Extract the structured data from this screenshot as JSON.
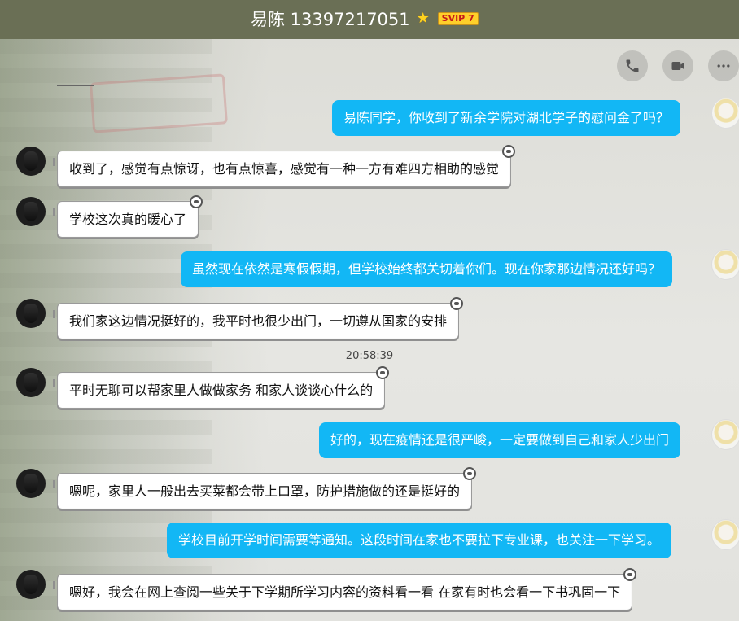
{
  "header": {
    "title": "易陈 13397217051",
    "vip": "SVIP 7"
  },
  "toolbar": {
    "buttons": [
      {
        "icon": "phone-icon"
      },
      {
        "icon": "video-icon"
      },
      {
        "icon": "more-icon"
      }
    ]
  },
  "messages": [
    {
      "side": "right",
      "text": "易陈同学，你收到了新余学院对湖北学子的慰问金了吗？"
    },
    {
      "side": "left",
      "text": "收到了，感觉有点惊讶，也有点惊喜，感觉有一种一方有难四方相助的感觉"
    },
    {
      "side": "left",
      "text": "学校这次真的暖心了"
    },
    {
      "side": "right",
      "text": "虽然现在依然是寒假假期，但学校始终都关切着你们。现在你家那边情况还好吗？"
    },
    {
      "side": "left",
      "text": "我们家这边情况挺好的，我平时也很少出门，一切遵从国家的安排"
    },
    {
      "side": "time",
      "text": "20:58:39"
    },
    {
      "side": "left",
      "text": "平时无聊可以帮家里人做做家务 和家人谈谈心什么的"
    },
    {
      "side": "right",
      "text": "好的，现在疫情还是很严峻，一定要做到自己和家人少出门"
    },
    {
      "side": "left",
      "text": "嗯呢，家里人一般出去买菜都会带上口罩，防护措施做的还是挺好的"
    },
    {
      "side": "right",
      "text": "学校目前开学时间需要等通知。这段时间在家也不要拉下专业课，也关注一下学习。"
    },
    {
      "side": "left",
      "text": "嗯好，我会在网上查阅一些关于下学期所学习内容的资料看一看 在家有时也会看一下书巩固一下"
    }
  ],
  "colors": {
    "titlebar": "#6a6f55",
    "bubble_right": "#12b7f5",
    "bubble_left": "#ffffff"
  }
}
